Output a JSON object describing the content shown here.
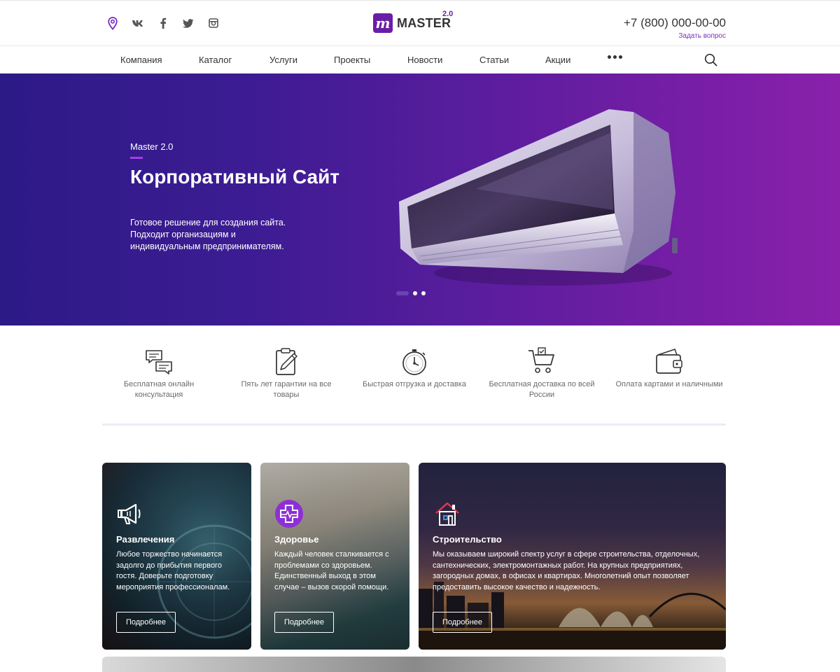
{
  "header": {
    "logo_letter": "m",
    "logo_text": "MASTER",
    "logo_version": "2.0",
    "phone": "+7 (800) 000-00-00",
    "ask_link": "Задать вопрос",
    "socials": [
      "location-icon",
      "vk-icon",
      "facebook-icon",
      "twitter-icon",
      "instagram-icon"
    ]
  },
  "nav": {
    "items": [
      "Компания",
      "Каталог",
      "Услуги",
      "Проекты",
      "Новости",
      "Статьи",
      "Акции"
    ]
  },
  "hero": {
    "kicker": "Master 2.0",
    "title": "Корпоративный Сайт",
    "description": "Готовое решение для создания сайта. Подходит организациям и индивидуальным предпринимателям.",
    "slides_count": 3,
    "active_slide": 1
  },
  "features": [
    {
      "icon": "chat-icon",
      "text": "Бесплатная онлайн консультация"
    },
    {
      "icon": "clipboard-pen-icon",
      "text": "Пять лет гарантии на все товары"
    },
    {
      "icon": "stopwatch-icon",
      "text": "Быстрая отгрузка и доставка"
    },
    {
      "icon": "cart-icon",
      "text": "Бесплатная доставка по всей России"
    },
    {
      "icon": "wallet-icon",
      "text": "Оплата картами и наличными"
    }
  ],
  "cards": [
    {
      "icon": "megaphone-icon",
      "title": "Развлечения",
      "text": "Любое торжество начинается задолго до прибытия первого гостя. Доверьте подготовку мероприятия профессионалам.",
      "button": "Подробнее"
    },
    {
      "icon": "medical-cross-icon",
      "title": "Здоровье",
      "text": "Каждый человек сталкивается с проблемами со здоровьем. Единственный выход в этом случае – вызов скорой помощи.",
      "button": "Подробнее"
    },
    {
      "icon": "house-icon",
      "title": "Строительство",
      "text": "Мы оказываем широкий спектр услуг в сфере строительства, отделочных, сантехнических, электромонтажных работ. На крупных предприятиях, загородных домах, в офисах и квартирах. Многолетний опыт позволяет предоставить высокое качество и надежность.",
      "button": "Подробнее"
    }
  ],
  "colors": {
    "brand": "#6a1ea8",
    "hero_start": "#2c1a86",
    "hero_end": "#8a21aa"
  }
}
